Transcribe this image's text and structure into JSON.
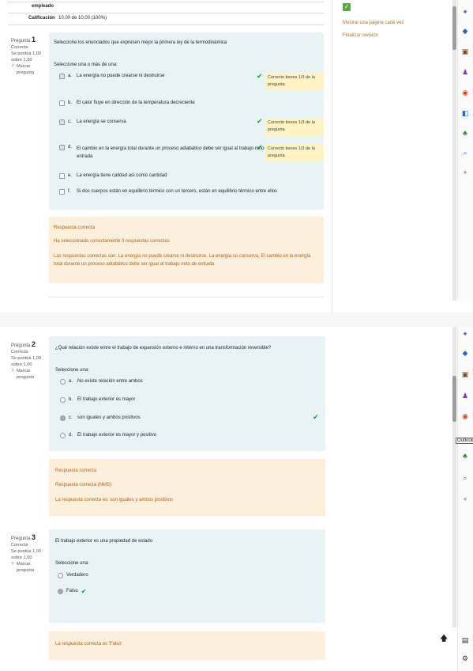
{
  "summary": {
    "employee_label": "empleado",
    "grade_label": "Calificación",
    "grade_value": "10,00 de 10,00 (100%)"
  },
  "right_nav": {
    "show_one_page_link": "Mostrar una página cada vez",
    "finish_review_link": "Finalizar revisión",
    "check_icon": "check-icon"
  },
  "q1": {
    "label_prefix": "Pregunta",
    "number": "1",
    "status": "Correcta",
    "score": "Se puntúa 1,00 sobre 1,00",
    "flag": "Marcar pregunta",
    "prompt": "Seleccione los enunciados que expresen mejor la primera ley de la termodinámica",
    "instruction": "Seleccione una o más de una:",
    "options": [
      {
        "letter": "a.",
        "text": "La energía no puede crearse ni destruirse",
        "checked": true,
        "feedback": "Correcto tienes 1/3 de la pregunta"
      },
      {
        "letter": "b.",
        "text": "El calor fluye en dirección de la temperatura decreciente",
        "checked": false,
        "feedback": ""
      },
      {
        "letter": "c.",
        "text": "La energía se conserva",
        "checked": true,
        "feedback": "Correcto tienes 1/3 de la pregunta"
      },
      {
        "letter": "d.",
        "text": "El cambio en la energía total durante un proceso adiabático debe ser igual al trabajo neto de entrada",
        "checked": true,
        "feedback": "Correcto tienes 1/3 de la pregunta"
      },
      {
        "letter": "e.",
        "text": "La energía tiene calidad así como cantidad",
        "checked": false,
        "feedback": ""
      },
      {
        "letter": "f.",
        "text": "Si dos cuerpos están en equilibrio térmico con un tercero, están en equilibrio térmico entre ellos",
        "checked": false,
        "feedback": ""
      }
    ],
    "result": "Respuesta correcta",
    "partial": "Ha seleccionado correctamente 3 respuestas correctas",
    "correct_answer": "Las respuestas correctas son: La energía no puede crearse ni destruirse, La energía se conserva, El cambio en la energía total durante un proceso adiabático debe ser igual al trabajo neto de entrada"
  },
  "q2": {
    "label_prefix": "Pregunta",
    "number": "2",
    "status": "Correcta",
    "score": "Se puntúa 1,00 sobre 1,00",
    "flag": "Marcar pregunta",
    "prompt": "¿Qué relación existe entre el trabajo de expansión externo e interno en una transformación reversible?",
    "instruction": "Seleccione una:",
    "options": [
      {
        "letter": "a.",
        "text": "No existe relación entre ambos",
        "selected": false
      },
      {
        "letter": "b.",
        "text": "El trabajo exterior es mayor",
        "selected": false
      },
      {
        "letter": "c.",
        "text": "son iguales y ambos positivos",
        "selected": true
      },
      {
        "letter": "d.",
        "text": "El trabajo exterior es mayor y positivo",
        "selected": false
      }
    ],
    "result": "Respuesta correcta",
    "correct_note": "Respuesta correcta (NMS)",
    "correct_answer": "La respuesta correcta es: son iguales y ambos positivos"
  },
  "q3": {
    "label_prefix": "Pregunta",
    "number": "3",
    "status": "Correcta",
    "score": "Se puntúa 1,00 sobre 1,00",
    "flag": "Marcar pregunta",
    "prompt": "El trabajo exterior es una propiedad de estado",
    "instruction": "Seleccione una:",
    "options": [
      {
        "text": "Verdadero",
        "selected": false
      },
      {
        "text": "Falso",
        "selected": true
      }
    ],
    "correct_answer": "La respuesta correcta es 'Falso'"
  },
  "tooltip": "Outlook",
  "sidebar_icons": [
    "copilot-icon",
    "diamond-icon",
    "briefcase-icon",
    "people-icon",
    "office-icon",
    "outlook-icon",
    "tree-icon",
    "search-icon",
    "plus-icon"
  ],
  "bottom_icons": [
    "arrow-up-icon",
    "layout-icon",
    "settings-icon"
  ],
  "colors": {
    "correct": "#1b9a33",
    "question_bg": "#e7f3f5",
    "feedback_bg": "#fcefdc",
    "link": "#b96a1e"
  }
}
